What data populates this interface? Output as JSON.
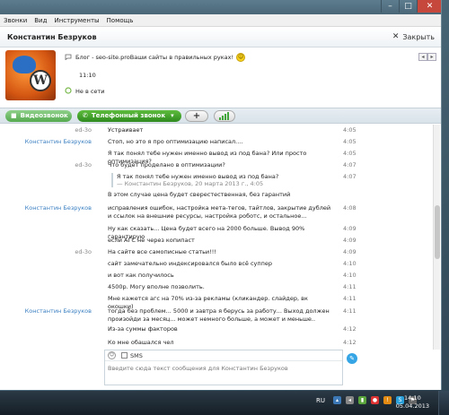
{
  "menu": [
    "Звонки",
    "Вид",
    "Инструменты",
    "Помощь"
  ],
  "window_controls": {
    "minimize": "–",
    "maximize": "□",
    "close": "✕"
  },
  "contact": {
    "name": "Константин Безруков",
    "close_label": "Закрыть",
    "mood": "Блог - seo-site.proВаши сайты в правильных руках!",
    "local_time": "11:10",
    "status": "Не в сети"
  },
  "toolbar": {
    "video": "Видеозвонок",
    "phone": "Телефонный звонок",
    "add": "+"
  },
  "messages": [
    {
      "sender": "ed-3o",
      "side": "me",
      "text": "Устраивает",
      "time": "4:05"
    },
    {
      "sender": "Константин Безруков",
      "side": "them",
      "text": "Стоп, но это я про оптимизацию написал....",
      "time": "4:05"
    },
    {
      "sender": "",
      "side": "them",
      "text": "Я так понял тебе нужен именно вывод из под бана? Или просто оптимизация?",
      "time": "4:05"
    },
    {
      "sender": "ed-3o",
      "side": "me",
      "text": "Что будет проделано в оптимизации?",
      "time": "4:07"
    },
    {
      "sender": "",
      "side": "them",
      "quote": {
        "text": "Я так понял тебе нужен именно вывод из под бана?",
        "meta": "— Константин Безруков, 20 марта 2013 г., 4:05"
      },
      "text": "",
      "time": "4:07"
    },
    {
      "sender": "",
      "side": "me",
      "text": "В этом случае цена будет сверестественная, без гарантий",
      "time": ""
    },
    {
      "sender": "Константин Безруков",
      "side": "them",
      "text": "исправления ошибок, настройка мета-тегов, тайтлов, закрытие дублей и ссылок на внешние ресурсы, настройка роботс, и остальное...",
      "time": "4:08"
    },
    {
      "sender": "",
      "side": "them",
      "text": "Ну как сказать... Цена будет всего на 2000 больше. Вывод 90% гарантирую",
      "time": "4:09"
    },
    {
      "sender": "",
      "side": "them",
      "text": "если АГС не через копипаст",
      "time": "4:09"
    },
    {
      "sender": "ed-3o",
      "side": "me",
      "text": "На сайте все самописные статьи!!!",
      "time": "4:09"
    },
    {
      "sender": "",
      "side": "me",
      "text": "сайт замечательно индексировался было всё суппер",
      "time": "4:10"
    },
    {
      "sender": "",
      "side": "me",
      "text": "и вот как получилось",
      "time": "4:10"
    },
    {
      "sender": "",
      "side": "me",
      "text": "4500р. Могу вполне позволить.",
      "time": "4:11"
    },
    {
      "sender": "",
      "side": "me",
      "text": "Мне кажется агс на 70% из-за рекламы (кликандер. слайдер, вк окошки)",
      "time": "4:11"
    },
    {
      "sender": "Константин Безруков",
      "side": "them",
      "text": "тогда без проблем... 5000 и завтра я берусь за работу... Выход должен произойди за месяц... может немного больше, а может и меньше..",
      "time": "4:11"
    },
    {
      "sender": "",
      "side": "them",
      "text": "Из-за суммы факторов",
      "time": "4:12"
    },
    {
      "sender": "",
      "side": "them",
      "text": "Ко мне обашался чел",
      "time": "4:12"
    }
  ],
  "composer": {
    "sms_label": "SMS",
    "placeholder": "Введите сюда текст сообщения для Константин Безруков"
  },
  "taskbar": {
    "lang": "RU",
    "time": "14:10",
    "date": "05.04.2013"
  }
}
